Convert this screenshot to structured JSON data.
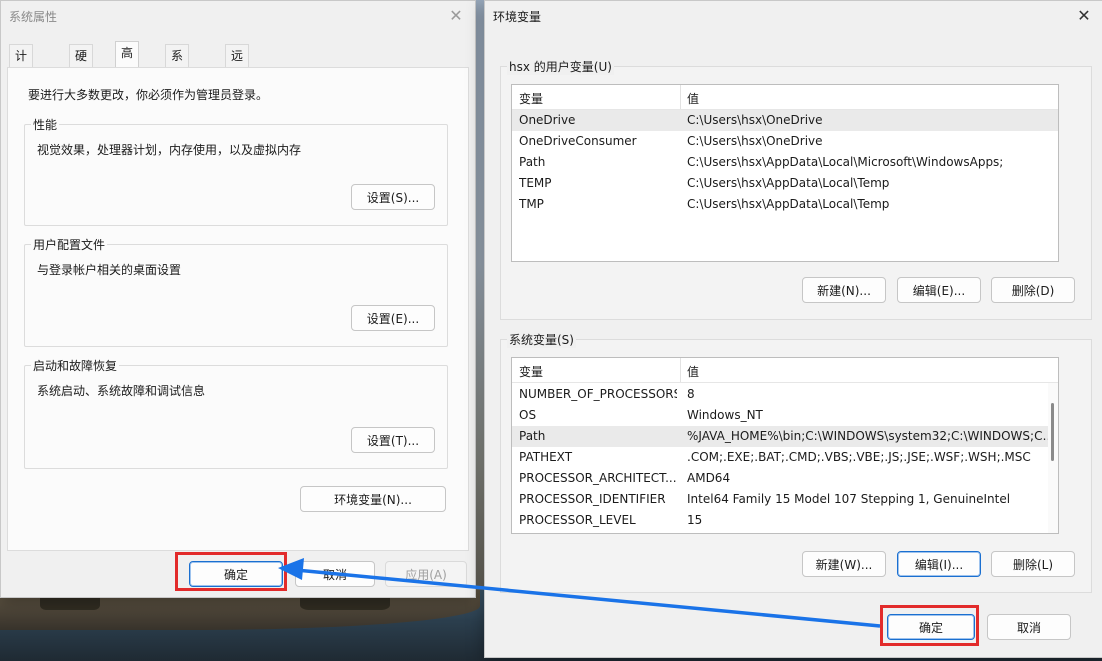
{
  "system_properties": {
    "title": "系统属性",
    "close_glyph": "✕",
    "tabs": [
      {
        "label": "计算机名"
      },
      {
        "label": "硬件"
      },
      {
        "label": "高级"
      },
      {
        "label": "系统保护"
      },
      {
        "label": "远程"
      }
    ],
    "admin_note": "要进行大多数更改，你必须作为管理员登录。",
    "performance": {
      "label": "性能",
      "desc": "视觉效果，处理器计划，内存使用，以及虚拟内存",
      "button": "设置(S)..."
    },
    "user_profiles": {
      "label": "用户配置文件",
      "desc": "与登录帐户相关的桌面设置",
      "button": "设置(E)..."
    },
    "startup_recovery": {
      "label": "启动和故障恢复",
      "desc": "系统启动、系统故障和调试信息",
      "button": "设置(T)..."
    },
    "env_button": "环境变量(N)...",
    "ok": "确定",
    "cancel": "取消",
    "apply": "应用(A)"
  },
  "environment_variables": {
    "title": "环境变量",
    "close_glyph": "✕",
    "user_vars": {
      "label": "hsx 的用户变量(U)",
      "col_var": "变量",
      "col_val": "值",
      "rows": [
        {
          "name": "OneDrive",
          "value": "C:\\Users\\hsx\\OneDrive"
        },
        {
          "name": "OneDriveConsumer",
          "value": "C:\\Users\\hsx\\OneDrive"
        },
        {
          "name": "Path",
          "value": "C:\\Users\\hsx\\AppData\\Local\\Microsoft\\WindowsApps;"
        },
        {
          "name": "TEMP",
          "value": "C:\\Users\\hsx\\AppData\\Local\\Temp"
        },
        {
          "name": "TMP",
          "value": "C:\\Users\\hsx\\AppData\\Local\\Temp"
        }
      ],
      "new": "新建(N)...",
      "edit": "编辑(E)...",
      "delete": "删除(D)"
    },
    "system_vars": {
      "label": "系统变量(S)",
      "col_var": "变量",
      "col_val": "值",
      "rows": [
        {
          "name": "NUMBER_OF_PROCESSORS",
          "value": "8"
        },
        {
          "name": "OS",
          "value": "Windows_NT"
        },
        {
          "name": "Path",
          "value": "%JAVA_HOME%\\bin;C:\\WINDOWS\\system32;C:\\WINDOWS;C:..."
        },
        {
          "name": "PATHEXT",
          "value": ".COM;.EXE;.BAT;.CMD;.VBS;.VBE;.JS;.JSE;.WSF;.WSH;.MSC"
        },
        {
          "name": "PROCESSOR_ARCHITECT...",
          "value": "AMD64"
        },
        {
          "name": "PROCESSOR_IDENTIFIER",
          "value": "Intel64 Family 15 Model 107 Stepping 1, GenuineIntel"
        },
        {
          "name": "PROCESSOR_LEVEL",
          "value": "15"
        }
      ],
      "new": "新建(W)...",
      "edit": "编辑(I)...",
      "delete": "删除(L)"
    },
    "ok": "确定",
    "cancel": "取消"
  },
  "colors": {
    "highlight": "#e22b2b",
    "arrow": "#1a73e8",
    "primary_border": "#1a6fd0"
  }
}
